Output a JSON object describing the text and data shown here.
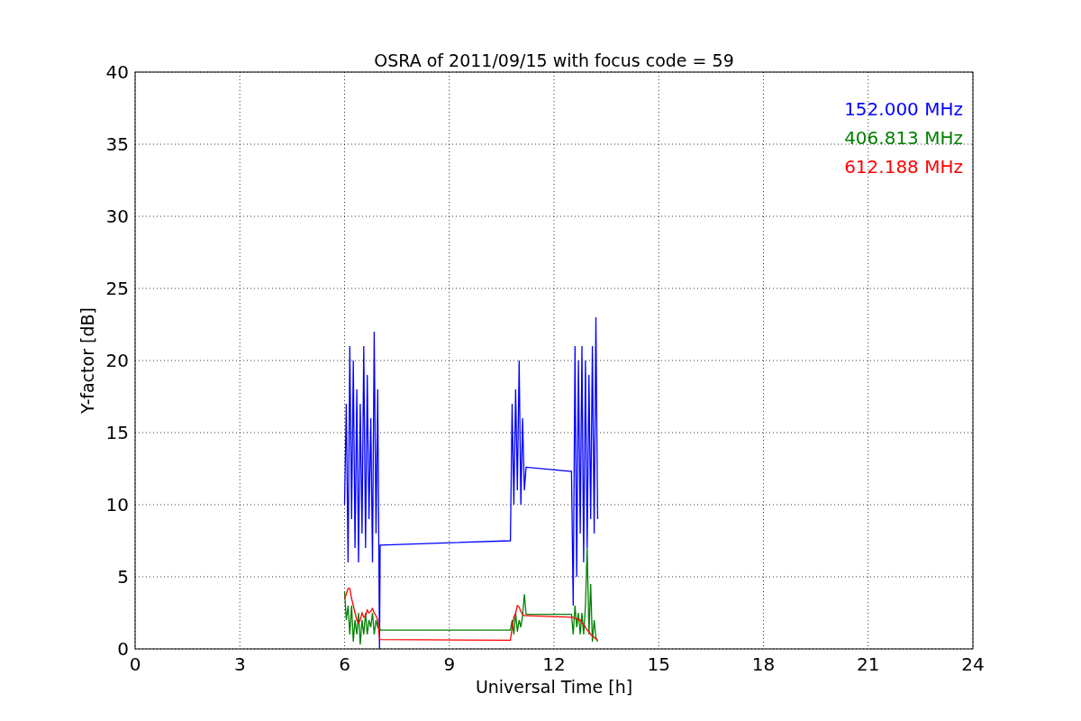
{
  "figure": {
    "chart_data": {
      "type": "line",
      "title": "OSRA of 2011/09/15 with focus code = 59",
      "xlabel": "Universal Time [h]",
      "ylabel": "Y-factor [dB]",
      "x": [
        6.0,
        6.05,
        6.1,
        6.15,
        6.2,
        6.25,
        6.3,
        6.35,
        6.4,
        6.45,
        6.5,
        6.55,
        6.6,
        6.65,
        6.7,
        6.75,
        6.8,
        6.85,
        6.9,
        6.95,
        7.0,
        7.02,
        10.75,
        10.8,
        10.85,
        10.9,
        10.95,
        11.0,
        11.05,
        11.1,
        11.15,
        11.2,
        12.5,
        12.55,
        12.6,
        12.65,
        12.7,
        12.75,
        12.8,
        12.85,
        12.9,
        12.95,
        13.0,
        13.05,
        13.1,
        13.15,
        13.2,
        13.25
      ],
      "series": [
        {
          "name": "152.000 MHz",
          "color": "#0000ff",
          "values": [
            10,
            17,
            6,
            21,
            9,
            20,
            7,
            18,
            6,
            17,
            8,
            21,
            7,
            19,
            9,
            16,
            6,
            22,
            8,
            18,
            0,
            7.2,
            7.5,
            17,
            10,
            18,
            11,
            20,
            10,
            16,
            11,
            12.6,
            12.3,
            3,
            21,
            5,
            20,
            8,
            21,
            6,
            20,
            7,
            19,
            9,
            21,
            8,
            23,
            9
          ]
        },
        {
          "name": "406.813 MHz",
          "color": "#008000",
          "values": [
            4,
            2,
            3,
            1,
            3,
            0.5,
            2,
            1,
            2.5,
            0.3,
            2,
            1,
            2.5,
            1,
            2,
            1.5,
            2.5,
            1,
            2,
            1.5,
            1.5,
            1.3,
            1.3,
            2,
            1,
            2.5,
            1.2,
            2,
            1.5,
            2.3,
            3.8,
            2.4,
            2.4,
            1,
            3,
            1.5,
            2.5,
            1,
            2.5,
            1,
            3,
            7,
            1,
            4.5,
            0.5,
            2,
            0.8,
            0.5
          ]
        },
        {
          "name": "612.188 MHz",
          "color": "#ff0000",
          "values": [
            3.5,
            3.8,
            4.2,
            4.2,
            3.5,
            3,
            2.5,
            2,
            1.8,
            2,
            2.5,
            2.2,
            2.3,
            2.7,
            2.5,
            2.6,
            2.8,
            2.5,
            2.3,
            2,
            0.7,
            0.65,
            0.6,
            1.5,
            2.2,
            2.5,
            3,
            2.9,
            2.6,
            2.4,
            2.3,
            2.3,
            2.2,
            2.2,
            2.1,
            2.1,
            2,
            2,
            1.8,
            1.7,
            1.5,
            1.3,
            1.2,
            1,
            0.9,
            0.8,
            0.7,
            0.6
          ]
        }
      ],
      "grid": true,
      "xlim": [
        0,
        24
      ],
      "ylim": [
        0,
        40
      ],
      "xticks": [
        0,
        3,
        6,
        9,
        12,
        15,
        18,
        21,
        24
      ],
      "yticks": [
        0,
        5,
        10,
        15,
        20,
        25,
        30,
        35,
        40
      ]
    }
  }
}
